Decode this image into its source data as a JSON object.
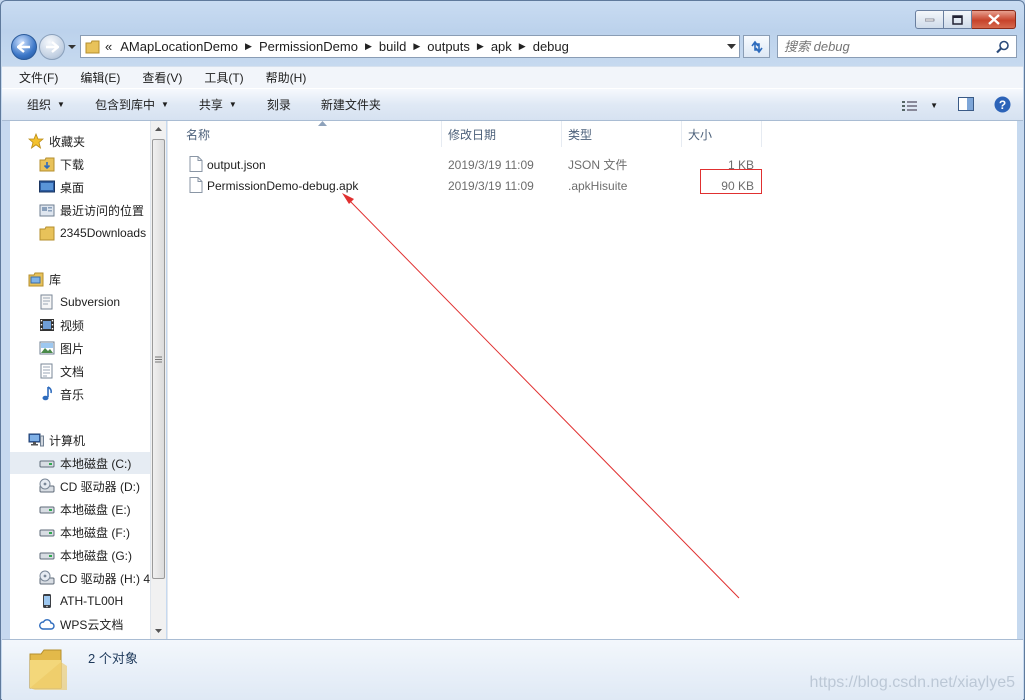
{
  "address": {
    "overflow": "«",
    "crumbs": [
      "AMapLocationDemo",
      "PermissionDemo",
      "build",
      "outputs",
      "apk",
      "debug"
    ]
  },
  "search": {
    "placeholder": "搜索 debug"
  },
  "menu": [
    "文件(F)",
    "编辑(E)",
    "查看(V)",
    "工具(T)",
    "帮助(H)"
  ],
  "commands": [
    {
      "label": "组织",
      "dropdown": true
    },
    {
      "label": "包含到库中",
      "dropdown": true
    },
    {
      "label": "共享",
      "dropdown": true
    },
    {
      "label": "刻录",
      "dropdown": false
    },
    {
      "label": "新建文件夹",
      "dropdown": false
    }
  ],
  "nav": {
    "favorites": {
      "label": "收藏夹",
      "items": [
        "下载",
        "桌面",
        "最近访问的位置",
        "2345Downloads"
      ]
    },
    "libraries": {
      "label": "库",
      "items": [
        "Subversion",
        "视频",
        "图片",
        "文档",
        "音乐"
      ]
    },
    "computer": {
      "label": "计算机",
      "items": [
        "本地磁盘 (C:)",
        "CD 驱动器 (D:)",
        "本地磁盘 (E:)",
        "本地磁盘 (F:)",
        "本地磁盘 (G:)",
        "CD 驱动器 (H:) 4",
        "ATH-TL00H",
        "WPS云文档"
      ]
    }
  },
  "columns": {
    "name": "名称",
    "modified": "修改日期",
    "type": "类型",
    "size": "大小"
  },
  "files": [
    {
      "name": "output.json",
      "modified": "2019/3/19 11:09",
      "type": "JSON 文件",
      "size": "1 KB"
    },
    {
      "name": "PermissionDemo-debug.apk",
      "modified": "2019/3/19 11:09",
      "type": ".apkHisuite",
      "size": "90 KB"
    }
  ],
  "status": {
    "count": "2 个对象"
  },
  "watermark": "https://blog.csdn.net/xiaylye5",
  "colors": {
    "annotation": "#e03030",
    "selection": "#e6ecf3",
    "chrome": "#c9dcf2"
  }
}
